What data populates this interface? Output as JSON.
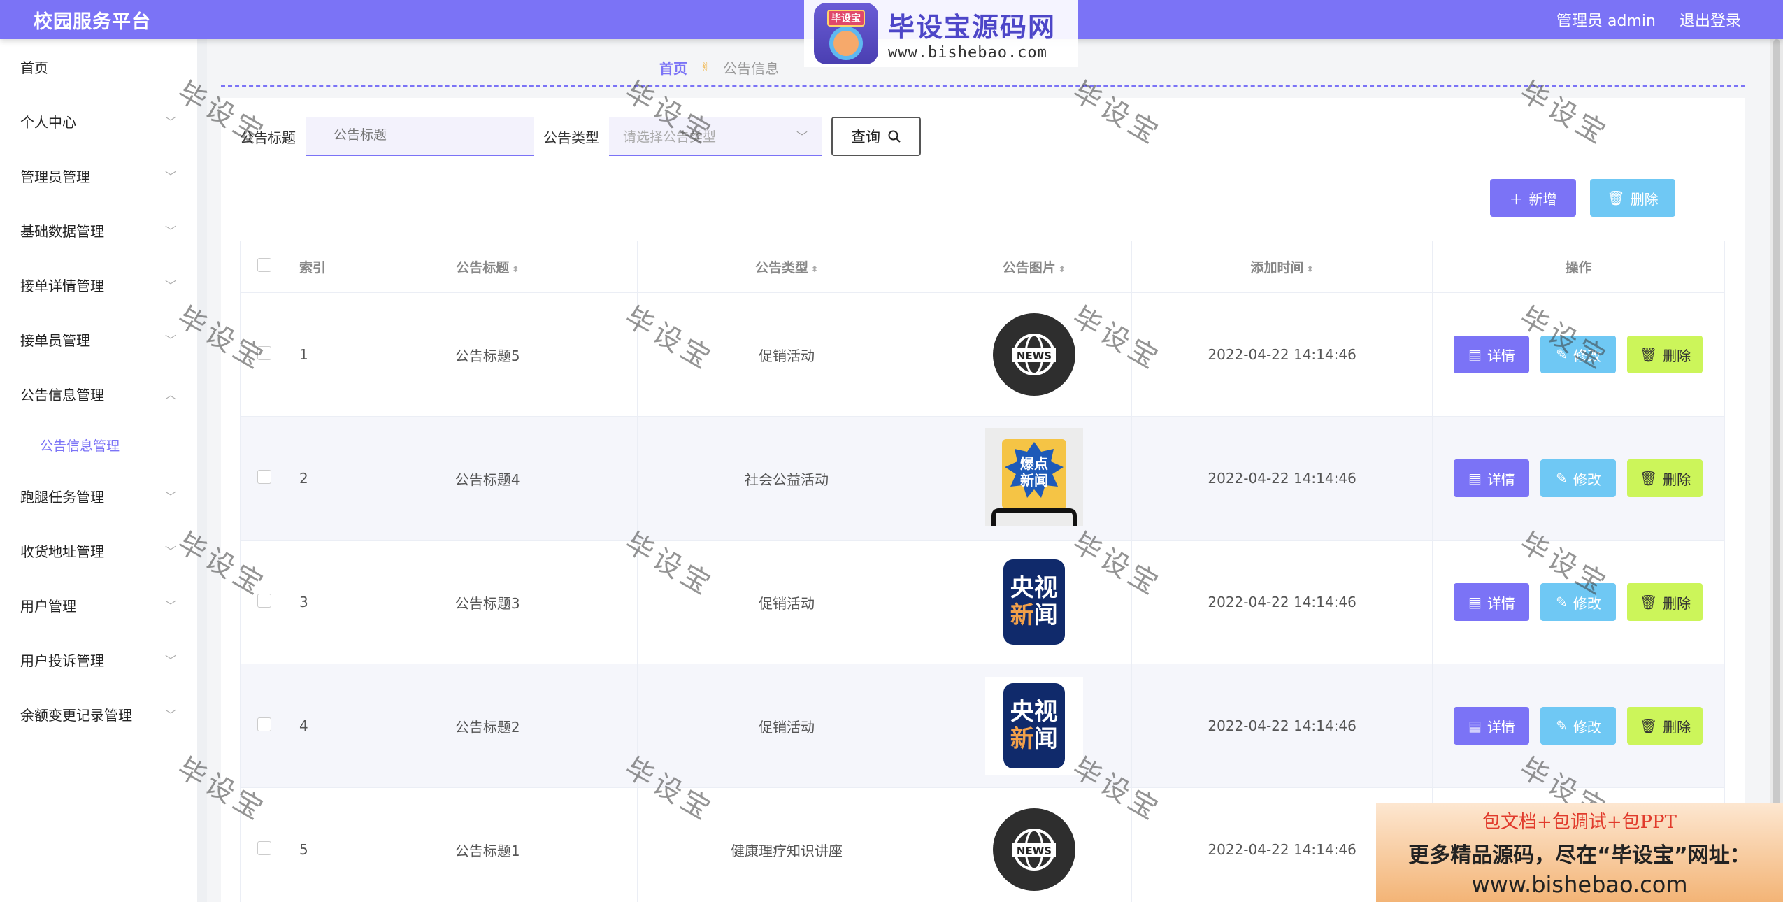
{
  "header": {
    "title": "校园服务平台",
    "user_label": "管理员 admin",
    "logout_label": "退出登录"
  },
  "watermark_logo": {
    "badge_text": "毕设宝",
    "title": "毕设宝源码网",
    "url": "www.bishebao.com"
  },
  "sidebar": {
    "items": [
      {
        "label": "首页"
      },
      {
        "label": "个人中心"
      },
      {
        "label": "管理员管理"
      },
      {
        "label": "基础数据管理"
      },
      {
        "label": "接单详情管理"
      },
      {
        "label": "接单员管理"
      },
      {
        "label": "公告信息管理",
        "expanded": true
      },
      {
        "label": "跑腿任务管理"
      },
      {
        "label": "收货地址管理"
      },
      {
        "label": "用户管理"
      },
      {
        "label": "用户投诉管理"
      },
      {
        "label": "余额变更记录管理"
      }
    ],
    "sub_item": "公告信息管理"
  },
  "breadcrumb": {
    "home": "首页",
    "current": "公告信息"
  },
  "search": {
    "title_label": "公告标题",
    "title_placeholder": "公告标题",
    "type_label": "公告类型",
    "type_placeholder": "请选择公告类型",
    "query_label": "查询"
  },
  "actions": {
    "add_label": "新增",
    "delete_label": "删除"
  },
  "table": {
    "columns": [
      "索引",
      "公告标题",
      "公告类型",
      "公告图片",
      "添加时间",
      "操作"
    ],
    "op_labels": {
      "detail": "详情",
      "edit": "修改",
      "delete": "删除"
    },
    "rows": [
      {
        "index": "1",
        "title": "公告标题5",
        "type": "促销活动",
        "image": "news-globe",
        "time": "2022-04-22 14:14:46"
      },
      {
        "index": "2",
        "title": "公告标题4",
        "type": "社会公益活动",
        "image": "burst-news",
        "time": "2022-04-22 14:14:46"
      },
      {
        "index": "3",
        "title": "公告标题3",
        "type": "促销活动",
        "image": "cctv-news",
        "time": "2022-04-22 14:14:46"
      },
      {
        "index": "4",
        "title": "公告标题2",
        "type": "促销活动",
        "image": "cctv-news",
        "time": "2022-04-22 14:14:46"
      },
      {
        "index": "5",
        "title": "公告标题1",
        "type": "健康理疗知识讲座",
        "image": "news-globe",
        "time": "2022-04-22 14:14:46"
      }
    ]
  },
  "image_texts": {
    "news": "NEWS",
    "burst_1": "爆点",
    "burst_2": "新闻",
    "cctv_1": "央视",
    "cctv_2a": "新",
    "cctv_2b": "闻"
  },
  "watermark_text": "毕设宝",
  "promo": {
    "line1": "包文档+包调试+包PPT",
    "line2": "更多精品源码，尽在“毕设宝”网址：",
    "line3": "www.bishebao.com"
  },
  "colors": {
    "primary": "#7b73f6",
    "edit": "#6fc8f4",
    "delete": "#ccf55a"
  }
}
